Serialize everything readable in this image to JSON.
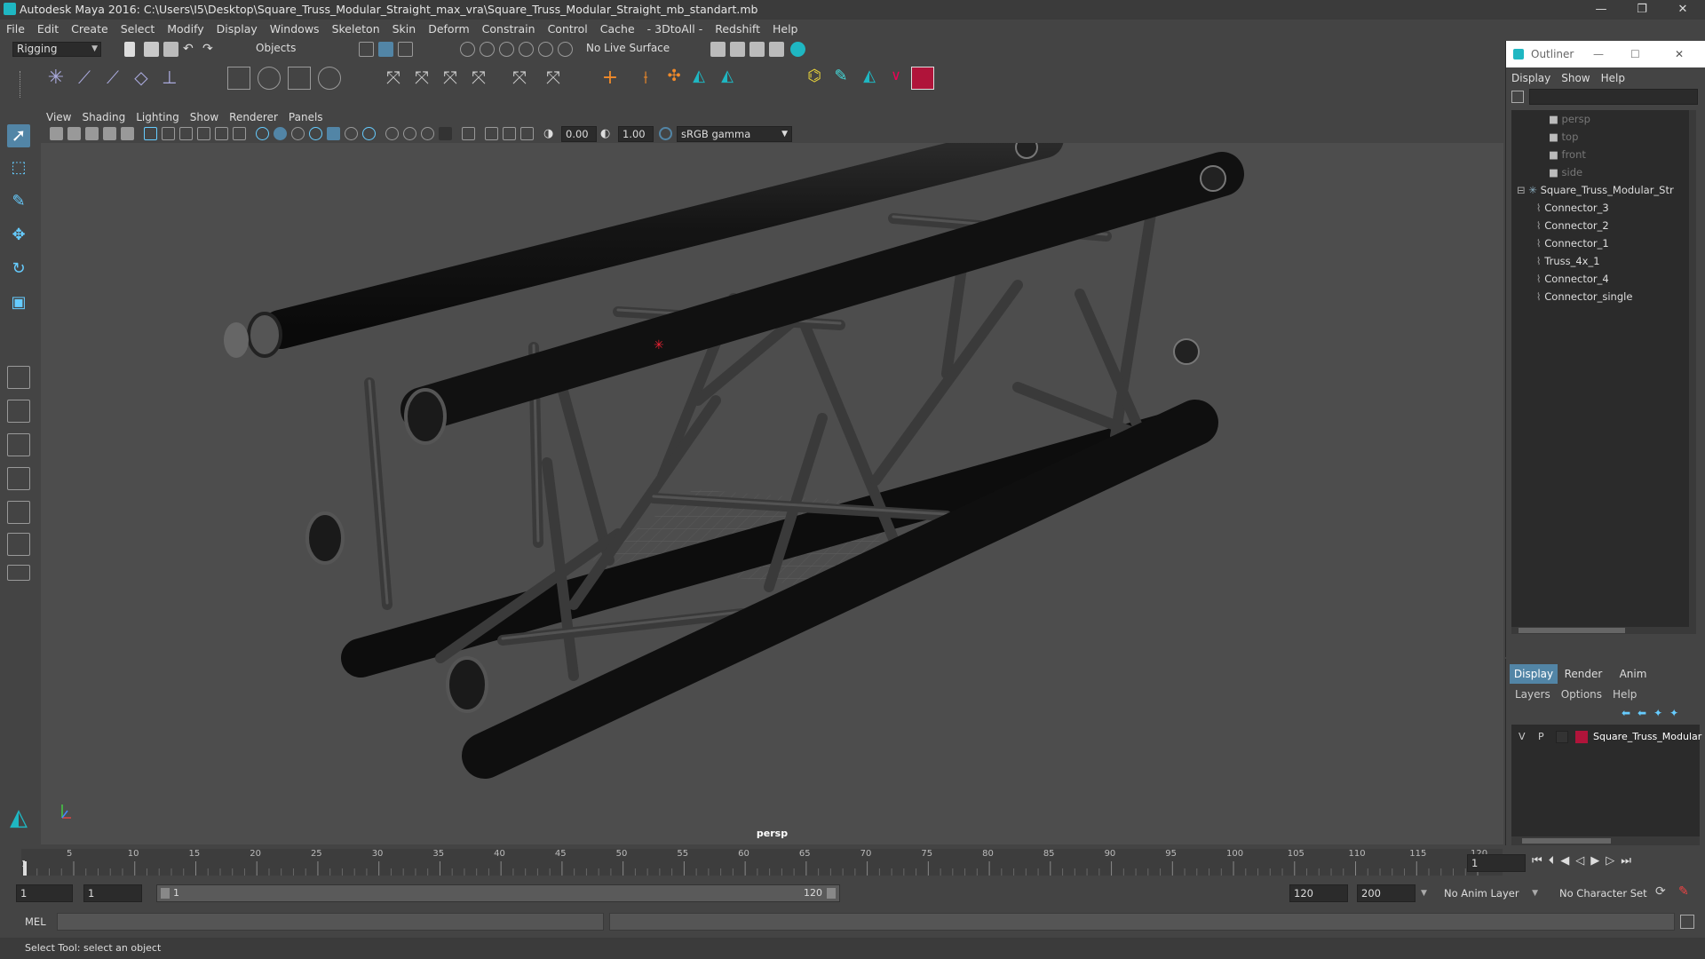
{
  "window": {
    "title": "Autodesk Maya 2016: C:\\Users\\I5\\Desktop\\Square_Truss_Modular_Straight_max_vra\\Square_Truss_Modular_Straight_mb_standart.mb",
    "minimize": "—",
    "maximize": "❐",
    "close": "✕"
  },
  "menubar": [
    "File",
    "Edit",
    "Create",
    "Select",
    "Modify",
    "Display",
    "Windows",
    "Skeleton",
    "Skin",
    "Deform",
    "Constrain",
    "Control",
    "Cache",
    "- 3DtoAll -",
    "Redshift",
    "Help"
  ],
  "statusline": {
    "mode": "Rigging",
    "selection_mode": "Objects",
    "live_surface": "No Live Surface"
  },
  "viewport": {
    "menu": [
      "View",
      "Shading",
      "Lighting",
      "Show",
      "Renderer",
      "Panels"
    ],
    "exposure": "0.00",
    "gamma": "1.00",
    "colorspace": "sRGB gamma",
    "camera_label": "persp"
  },
  "outliner": {
    "title": "Outliner",
    "menu": [
      "Display",
      "Show",
      "Help"
    ],
    "cameras": [
      "persp",
      "top",
      "front",
      "side"
    ],
    "group": "Square_Truss_Modular_Str",
    "children": [
      "Connector_3",
      "Connector_2",
      "Connector_1",
      "Truss_4x_1",
      "Connector_4",
      "Connector_single"
    ]
  },
  "layers": {
    "tabs": [
      "Display",
      "Render",
      "Anim"
    ],
    "menu": [
      "Layers",
      "Options",
      "Help"
    ],
    "layer": {
      "v": "V",
      "p": "P",
      "name": "Square_Truss_Modular",
      "color": "#b0143a"
    }
  },
  "timeline": {
    "ticks": [
      "5",
      "10",
      "15",
      "20",
      "25",
      "30",
      "35",
      "40",
      "45",
      "50",
      "55",
      "60",
      "65",
      "70",
      "75",
      "80",
      "85",
      "90",
      "95",
      "100",
      "105",
      "110",
      "115",
      "120"
    ],
    "start_marker": "1",
    "current_frame": "1"
  },
  "range": {
    "start": "1",
    "playback_start": "1",
    "slider_start": "1",
    "slider_end": "120",
    "playback_end": "120",
    "end": "200",
    "anim_layer": "No Anim Layer",
    "character_set": "No Character Set"
  },
  "mel": {
    "label": "MEL"
  },
  "helpline": "Select Tool: select an object",
  "colors": {
    "maya_accent": "#1fb7c2",
    "selected_tab": "#5285a6",
    "layer_color": "#b0143a"
  }
}
